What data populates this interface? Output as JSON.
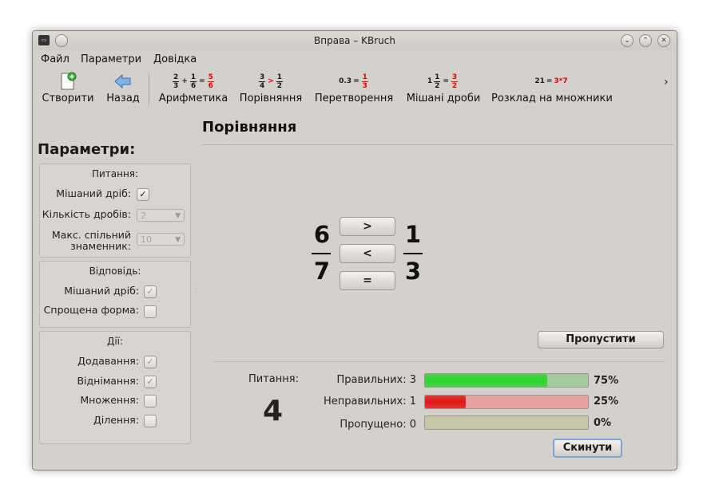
{
  "window": {
    "title": "Вправа – KBruch"
  },
  "menu": [
    {
      "label": "Файл"
    },
    {
      "label": "Параметри"
    },
    {
      "label": "Довідка"
    }
  ],
  "toolbar": {
    "create_label": "Створити",
    "back_label": "Назад",
    "arithmetic_label": "Арифметика",
    "comparison_label": "Порівняння",
    "conversion_label": "Перетворення",
    "mixed_label": "Мішані дроби",
    "factorization_label": "Розклад на множники",
    "arithmetic_icon": {
      "a_num": "2",
      "a_den": "3",
      "op": "+",
      "b_num": "1",
      "b_den": "6",
      "eq": "=",
      "r_num": "5",
      "r_den": "6"
    },
    "comparison_icon": {
      "a_num": "3",
      "a_den": "4",
      "op": ">",
      "b_num": "1",
      "b_den": "2"
    },
    "conversion_icon": {
      "lhs": "0.3",
      "eq": "=",
      "r_num": "1",
      "r_den": "3"
    },
    "mixed_icon": {
      "whole": "1",
      "a_num": "1",
      "a_den": "2",
      "eq": "=",
      "r_num": "3",
      "r_den": "2"
    },
    "factor_icon": {
      "lhs": "21",
      "eq": "=",
      "rhs": "3*7"
    },
    "overflow": "›"
  },
  "section_title": "Порівняння",
  "params": {
    "title": "Параметри:",
    "task_group": {
      "title": "Питання:",
      "mixed_label": "Мішаний дріб:",
      "mixed_checked": "✓",
      "count_label": "Кількість дробів:",
      "count_value": "2",
      "maxden_label_1": "Макс. спільний",
      "maxden_label_2": "знаменник:",
      "maxden_value": "10"
    },
    "answer_group": {
      "title": "Відповідь:",
      "mixed_label": "Мішаний дріб:",
      "mixed_checked": "✓",
      "reduced_label": "Спрощена форма:"
    },
    "ops_group": {
      "title": "Дії:",
      "add_label": "Додавання:",
      "add_checked": "✓",
      "sub_label": "Віднімання:",
      "sub_checked": "✓",
      "mul_label": "Множення:",
      "div_label": "Ділення:"
    }
  },
  "exercise": {
    "left": {
      "num": "6",
      "den": "7"
    },
    "right": {
      "num": "1",
      "den": "3"
    },
    "btn_gt": ">",
    "btn_lt": "<",
    "btn_eq": "="
  },
  "skip_button": "Пропустити",
  "stats": {
    "task_label": "Питання:",
    "task_number": "4",
    "correct_label": "Правильних: 3",
    "correct_pct": "75%",
    "correct_fraction": 0.75,
    "wrong_label": "Неправильних: 1",
    "wrong_pct": "25%",
    "wrong_fraction": 0.25,
    "skipped_label": "Пропущено: 0",
    "skipped_pct": "0%",
    "skipped_fraction": 0,
    "colors": {
      "correct": "#2ed62e",
      "wrong": "#e01a1a",
      "correct_bg": "#a7c9a1",
      "wrong_bg": "#e5a0a0",
      "skipped_bg": "#c8c6a8"
    }
  },
  "reset_button": "Скинути"
}
